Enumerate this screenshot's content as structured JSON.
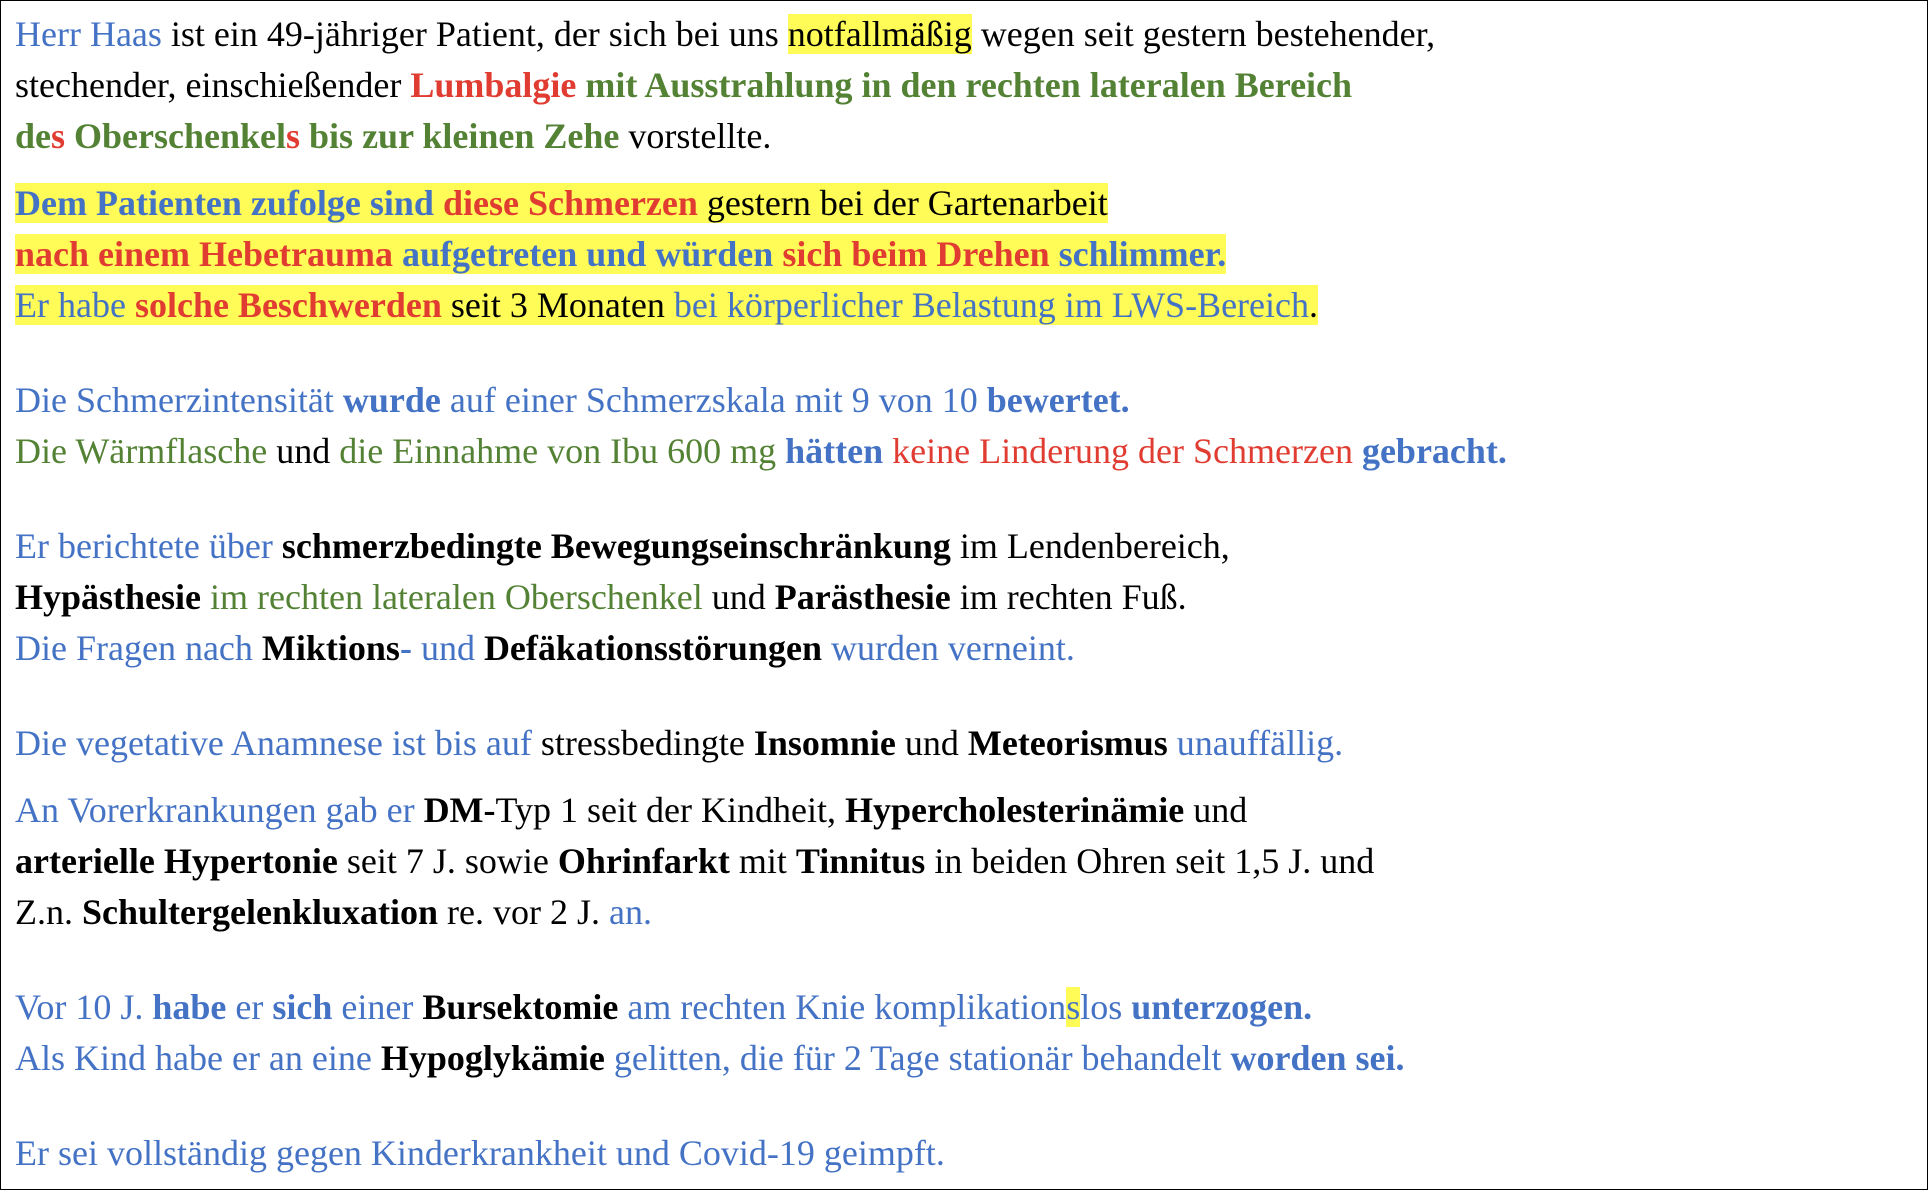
{
  "colors": {
    "blue": "#4472c4",
    "green": "#548235",
    "red": "#e03c31",
    "black": "#000000",
    "highlight": "#fffb57"
  },
  "paragraphs": [
    {
      "lines": [
        [
          {
            "t": "Herr Haas",
            "c": "blue"
          },
          {
            "t": " ist ein 49-jähriger Patient, der sich bei uns ",
            "c": "black"
          },
          {
            "t": "notfallmäßig",
            "c": "black",
            "hl": true
          },
          {
            "t": " wegen seit gestern bestehender,",
            "c": "black"
          }
        ],
        [
          {
            "t": "stechender, einschießender ",
            "c": "black"
          },
          {
            "t": "Lumbalgie",
            "c": "red",
            "b": true
          },
          {
            "t": " mit Ausstrahlung in den rechten lateralen Bereich",
            "c": "green",
            "b": true
          }
        ],
        [
          {
            "t": "de",
            "c": "green",
            "b": true
          },
          {
            "t": "s",
            "c": "red",
            "b": true
          },
          {
            "t": " Oberschenkel",
            "c": "green",
            "b": true
          },
          {
            "t": "s",
            "c": "red",
            "b": true
          },
          {
            "t": " bis zur kleinen Zehe",
            "c": "green",
            "b": true
          },
          {
            "t": " vorstellte.",
            "c": "black"
          }
        ]
      ]
    },
    {
      "gap": "s",
      "lines": [
        [
          {
            "t": "Dem Patienten zufolge sind ",
            "c": "blue",
            "b": true,
            "hl": true
          },
          {
            "t": "diese Schmerzen",
            "c": "red",
            "b": true,
            "hl": true
          },
          {
            "t": " gestern bei der Gartenarbeit",
            "c": "black",
            "hl": true
          }
        ],
        [
          {
            "t": "nach einem Hebetrauma",
            "c": "red",
            "b": true,
            "hl": true
          },
          {
            "t": " aufgetreten und würden ",
            "c": "blue",
            "b": true,
            "hl": true
          },
          {
            "t": "sich beim Drehen",
            "c": "red",
            "b": true,
            "hl": true
          },
          {
            "t": " schlimmer.",
            "c": "blue",
            "b": true,
            "hl": true
          }
        ],
        [
          {
            "t": "Er habe ",
            "c": "blue",
            "hl": true
          },
          {
            "t": "solche Beschwerden",
            "c": "red",
            "b": true,
            "hl": true
          },
          {
            "t": " seit 3 Monaten ",
            "c": "black",
            "hl": true
          },
          {
            "t": "bei körperlicher Belastung im LWS-Bereich",
            "c": "blue",
            "hl": true
          },
          {
            "t": ".",
            "c": "black",
            "hl": true
          }
        ]
      ]
    },
    {
      "gap": "l",
      "lines": [
        [
          {
            "t": "Die Schmerzintensität ",
            "c": "blue"
          },
          {
            "t": "wurde",
            "c": "blue",
            "b": true
          },
          {
            "t": " auf einer Schmerzskala mit 9 von 10 ",
            "c": "blue"
          },
          {
            "t": "bewertet.",
            "c": "blue",
            "b": true
          }
        ],
        [
          {
            "t": "Die Wärmflasche",
            "c": "green"
          },
          {
            "t": " und ",
            "c": "black"
          },
          {
            "t": "die Einnahme von Ibu 600 mg ",
            "c": "green"
          },
          {
            "t": "hätten",
            "c": "blue",
            "b": true
          },
          {
            "t": " keine Linderung der Schmerzen ",
            "c": "red"
          },
          {
            "t": "gebracht.",
            "c": "blue",
            "b": true
          }
        ]
      ]
    },
    {
      "gap": "l",
      "lines": [
        [
          {
            "t": "Er berichtete über ",
            "c": "blue"
          },
          {
            "t": "schmerzbedingte Bewegungseinschränkung",
            "c": "black",
            "b": true
          },
          {
            "t": " im Lendenbereich,",
            "c": "black"
          }
        ],
        [
          {
            "t": "Hypästhesie",
            "c": "black",
            "b": true
          },
          {
            "t": " im rechten lateralen Oberschenkel",
            "c": "green"
          },
          {
            "t": " und ",
            "c": "black"
          },
          {
            "t": "Parästhesie",
            "c": "black",
            "b": true
          },
          {
            "t": " im rechten Fuß.",
            "c": "black"
          }
        ],
        [
          {
            "t": "Die Fragen nach ",
            "c": "blue"
          },
          {
            "t": "Miktions",
            "c": "black",
            "b": true
          },
          {
            "t": "-",
            "c": "blue",
            "b": true
          },
          {
            "t": " und ",
            "c": "blue"
          },
          {
            "t": "Defäkationsstörungen",
            "c": "black",
            "b": true
          },
          {
            "t": " wurden verneint.",
            "c": "blue"
          }
        ]
      ]
    },
    {
      "gap": "l",
      "lines": [
        [
          {
            "t": "Die vegetative Anamnese ist bis auf ",
            "c": "blue"
          },
          {
            "t": "stressbedingte ",
            "c": "black"
          },
          {
            "t": "Insomnie",
            "c": "black",
            "b": true
          },
          {
            "t": " und ",
            "c": "black"
          },
          {
            "t": "Meteorismus",
            "c": "black",
            "b": true
          },
          {
            "t": " unauffällig.",
            "c": "blue"
          }
        ]
      ]
    },
    {
      "gap": "s",
      "lines": [
        [
          {
            "t": "An Vorerkrankungen gab er ",
            "c": "blue"
          },
          {
            "t": "DM-",
            "c": "black",
            "b": true
          },
          {
            "t": "Typ 1 seit der Kindheit, ",
            "c": "black"
          },
          {
            "t": "Hypercholesterinämie",
            "c": "black",
            "b": true
          },
          {
            "t": " und",
            "c": "black"
          }
        ],
        [
          {
            "t": "arterielle Hypertonie",
            "c": "black",
            "b": true
          },
          {
            "t": " seit 7 J. sowie ",
            "c": "black"
          },
          {
            "t": "Ohrinfarkt",
            "c": "black",
            "b": true
          },
          {
            "t": " mit ",
            "c": "black"
          },
          {
            "t": "Tinnitus",
            "c": "black",
            "b": true
          },
          {
            "t": " in beiden Ohren seit 1,5 J. und",
            "c": "black"
          }
        ],
        [
          {
            "t": "Z.n. ",
            "c": "black"
          },
          {
            "t": "Schultergelenkluxation",
            "c": "black",
            "b": true
          },
          {
            "t": " re. vor 2 J. ",
            "c": "black"
          },
          {
            "t": "an.",
            "c": "blue"
          }
        ]
      ]
    },
    {
      "gap": "l",
      "lines": [
        [
          {
            "t": "Vor 10 J. ",
            "c": "blue"
          },
          {
            "t": "habe",
            "c": "blue",
            "b": true
          },
          {
            "t": " er ",
            "c": "blue"
          },
          {
            "t": "sich",
            "c": "blue",
            "b": true
          },
          {
            "t": " einer ",
            "c": "blue"
          },
          {
            "t": "Bursektomie",
            "c": "black",
            "b": true
          },
          {
            "t": " am rechten Knie komplikation",
            "c": "blue"
          },
          {
            "t": "s",
            "c": "blue",
            "hl": true
          },
          {
            "t": "los ",
            "c": "blue"
          },
          {
            "t": "unterzogen.",
            "c": "blue",
            "b": true
          }
        ],
        [
          {
            "t": "Als Kind habe er an eine ",
            "c": "blue"
          },
          {
            "t": "Hypoglykämie",
            "c": "black",
            "b": true
          },
          {
            "t": " gelitten, die für 2 Tage stationär behandelt ",
            "c": "blue"
          },
          {
            "t": "worden sei.",
            "c": "blue",
            "b": true
          }
        ]
      ]
    },
    {
      "gap": "l",
      "lines": [
        [
          {
            "t": "Er sei vollständig gegen Kinderkrankheit und Covid-19 geimpft.",
            "c": "blue"
          }
        ]
      ]
    }
  ]
}
